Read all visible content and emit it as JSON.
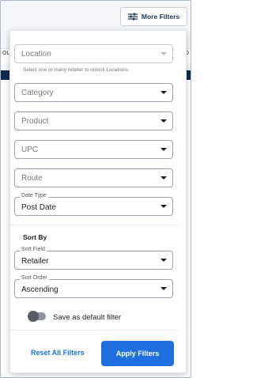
{
  "toolbar": {
    "more_filters_label": "More Filters",
    "left_column_fragment": "OL",
    "right_column_fragment": "OO"
  },
  "filters": {
    "location": {
      "placeholder": "Location",
      "helper": "Select one or many retailer to unlock Locations."
    },
    "category": {
      "placeholder": "Category"
    },
    "product": {
      "placeholder": "Product"
    },
    "upc": {
      "placeholder": "UPC"
    },
    "route": {
      "placeholder": "Route"
    },
    "date_type": {
      "label": "Date Type",
      "value": "Post Date"
    }
  },
  "sort": {
    "heading": "Sort By",
    "field": {
      "label": "Sort Field",
      "value": "Retailer"
    },
    "order": {
      "label": "Sort Order",
      "value": "Ascending"
    }
  },
  "default_toggle": {
    "label": "Save as default filter",
    "on": false
  },
  "actions": {
    "reset_label": "Reset All Filters",
    "apply_label": "Apply Filters"
  },
  "colors": {
    "primary": "#1f6fe0",
    "link": "#1a73e8",
    "header_bar": "#122a4e"
  }
}
